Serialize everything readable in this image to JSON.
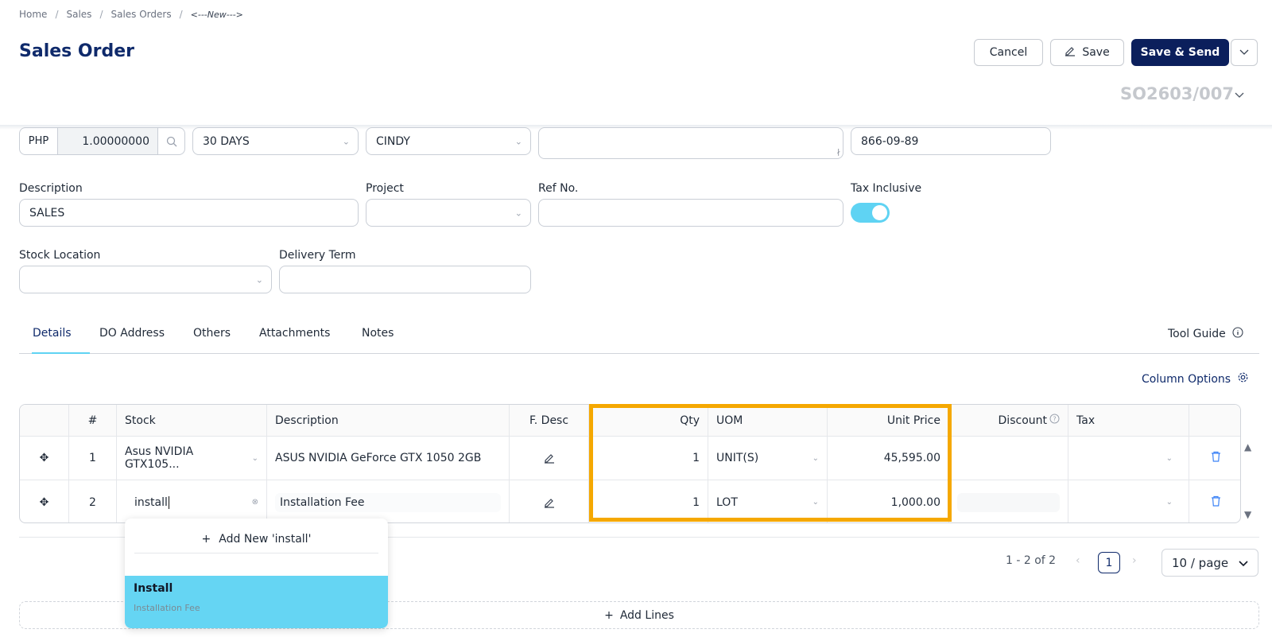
{
  "breadcrumb": {
    "home": "Home",
    "sales": "Sales",
    "sales_orders": "Sales Orders",
    "current": "<---New--->"
  },
  "page_title": "Sales Order",
  "actions": {
    "cancel": "Cancel",
    "save": "Save",
    "save_send": "Save & Send"
  },
  "so_number": "SO2603/007",
  "fields": {
    "currency_code": "PHP",
    "exchange_rate": "1.00000000",
    "terms": "30 DAYS",
    "agent": "CINDY",
    "phone": "866-09-89",
    "description_label": "Description",
    "description_value": "SALES",
    "project_label": "Project",
    "ref_no_label": "Ref No.",
    "tax_inclusive_label": "Tax Inclusive",
    "tax_inclusive_on": true,
    "stock_location_label": "Stock Location",
    "delivery_term_label": "Delivery Term"
  },
  "tabs": [
    "Details",
    "DO Address",
    "Others",
    "Attachments",
    "Notes"
  ],
  "tool_guide": "Tool Guide",
  "column_options": "Column Options",
  "table": {
    "headers": [
      "#",
      "Stock",
      "Description",
      "F. Desc",
      "Qty",
      "UOM",
      "Unit Price",
      "Discount",
      "Tax"
    ],
    "rows": [
      {
        "num": "1",
        "stock": "Asus NVIDIA GTX105...",
        "description": "ASUS NVIDIA GeForce GTX 1050 2GB",
        "qty": "1",
        "uom": "UNIT(S)",
        "unit_price": "45,595.00"
      },
      {
        "num": "2",
        "stock": "install",
        "description": "Installation Fee",
        "qty": "1",
        "uom": "LOT",
        "unit_price": "1,000.00"
      }
    ]
  },
  "dropdown": {
    "add_new": "Add New 'install'",
    "option_title": "Install",
    "option_subtitle": "Installation Fee"
  },
  "pagination": {
    "range": "1 - 2 of 2",
    "current_page": "1",
    "page_size": "10 / page"
  },
  "add_lines": "Add Lines",
  "colors": {
    "primary": "#0b1f5c",
    "accent": "#5fd3f3",
    "highlight": "#f5a800"
  }
}
